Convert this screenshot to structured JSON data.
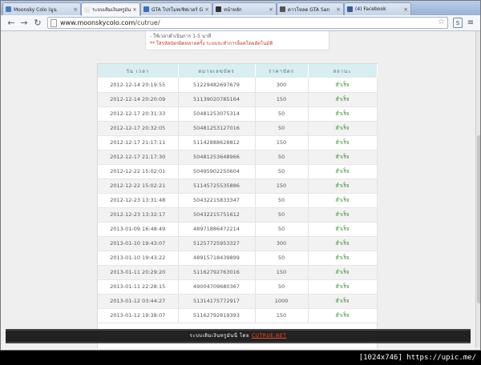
{
  "tabs": [
    {
      "label": "Moonsky Colo (มูน",
      "favicon_color": "#4a7bc8"
    },
    {
      "label": "ระบบเติมเงินทรูมันนี่",
      "favicon_color": "#e7e7e7"
    },
    {
      "label": "GTA โปรโมทเซิฟเวอร์ G",
      "favicon_color": "#3c6fb6"
    },
    {
      "label": "หน้าหลัก",
      "favicon_color": "#333333"
    },
    {
      "label": "ดาวโหลด GTA San",
      "favicon_color": "#555555"
    },
    {
      "label": "(4) Facebook",
      "favicon_color": "#3b5998"
    }
  ],
  "toolbar": {
    "back_glyph": "←",
    "forward_glyph": "→",
    "reload_glyph": "↻",
    "url_host": "www.moonskycolo.com",
    "url_path": "/cutrue/",
    "star_glyph": "☆",
    "wrench_glyph": "≡"
  },
  "notes": {
    "line1": "- ใช้เวลาดำเนินการ 1-5 นาที",
    "line2": "** ใส่รหัสบัตรผิดหลายครั้ง ระบบจะทำการล็อคโดยอัตโนมัติ"
  },
  "table": {
    "headers": [
      "วัน เวลา",
      "หมายเลขบัตร",
      "ราคาบัตร",
      "สถานะ"
    ],
    "rows": [
      [
        "2012-12-14 20:19:55",
        "51229482697679",
        "300",
        "สำเร็จ"
      ],
      [
        "2012-12-14 20:20:09",
        "51139020785164",
        "150",
        "สำเร็จ"
      ],
      [
        "2012-12-17 20:31:33",
        "50481253075314",
        "50",
        "สำเร็จ"
      ],
      [
        "2012-12-17 20:32:05",
        "50481253127016",
        "50",
        "สำเร็จ"
      ],
      [
        "2012-12-17 21:17:11",
        "51142888628812",
        "150",
        "สำเร็จ"
      ],
      [
        "2012-12-17 21:17:30",
        "50481253648966",
        "50",
        "สำเร็จ"
      ],
      [
        "2012-12-22 15:02:01",
        "50495902250604",
        "50",
        "สำเร็จ"
      ],
      [
        "2012-12-22 15:02:21",
        "51145725535886",
        "150",
        "สำเร็จ"
      ],
      [
        "2012-12-23 13:31:48",
        "50432215833347",
        "50",
        "สำเร็จ"
      ],
      [
        "2012-12-23 13:32:17",
        "50432215751612",
        "50",
        "สำเร็จ"
      ],
      [
        "2013-01-09 16:48:49",
        "48971886472214",
        "50",
        "สำเร็จ"
      ],
      [
        "2013-01-10 19:43:07",
        "51257725953327",
        "300",
        "สำเร็จ"
      ],
      [
        "2013-01-10 19:43:22",
        "48915718439899",
        "50",
        "สำเร็จ"
      ],
      [
        "2013-01-11 20:29:20",
        "51162792763016",
        "150",
        "สำเร็จ"
      ],
      [
        "2013-01-11 22:28:15",
        "49004709680367",
        "50",
        "สำเร็จ"
      ],
      [
        "2013-01-12 03:44:27",
        "51314175772917",
        "1000",
        "สำเร็จ"
      ],
      [
        "2013-01-12 19:38:07",
        "51162792819393",
        "150",
        "สำเร็จ"
      ]
    ]
  },
  "footer": {
    "text": "ระบบเติมเงินทรูมันนี่ โดย",
    "link": "CUTRUE.NET"
  },
  "watermark": "[1024x746] https://upic.me/",
  "colors": {
    "header_bg": "#d8eef0",
    "status_green": "#2f8a2f",
    "note_red": "#c0392b",
    "footer_link": "#ff4a2a"
  }
}
